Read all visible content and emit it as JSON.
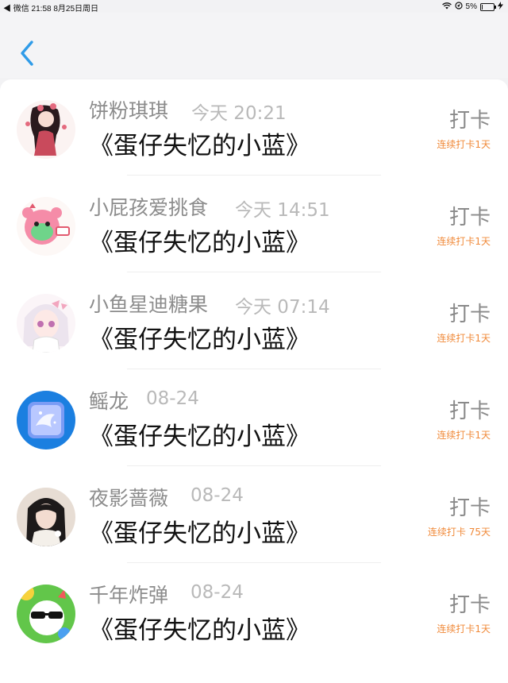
{
  "status_bar": {
    "left": "◀ 微信   21:58   8月25日周日",
    "battery": "5%",
    "battery_level": 0.05
  },
  "nav": {
    "back_icon": "chevron-left-icon",
    "accent": "#2f9be8"
  },
  "entries": [
    {
      "name": "饼粉琪琪",
      "time": "今天 20:21",
      "title": "《蛋仔失忆的小蓝》",
      "action": "打卡",
      "streak": "连续打卡1天"
    },
    {
      "name": "小屁孩爱挑食",
      "time": "今天 14:51",
      "title": "《蛋仔失忆的小蓝》",
      "action": "打卡",
      "streak": "连续打卡1天"
    },
    {
      "name": "小鱼星迪糖果",
      "time": "今天 07:14",
      "title": "《蛋仔失忆的小蓝》",
      "action": "打卡",
      "streak": "连续打卡1天"
    },
    {
      "name": "鳐龙",
      "time": "08-24",
      "title": "《蛋仔失忆的小蓝》",
      "action": "打卡",
      "streak": "连续打卡1天"
    },
    {
      "name": "夜影蔷薇",
      "time": "08-24",
      "title": "《蛋仔失忆的小蓝》",
      "action": "打卡",
      "streak": "连续打卡 75天"
    },
    {
      "name": "千年炸弹",
      "time": "08-24",
      "title": "《蛋仔失忆的小蓝》",
      "action": "打卡",
      "streak": "连续打卡1天"
    }
  ]
}
